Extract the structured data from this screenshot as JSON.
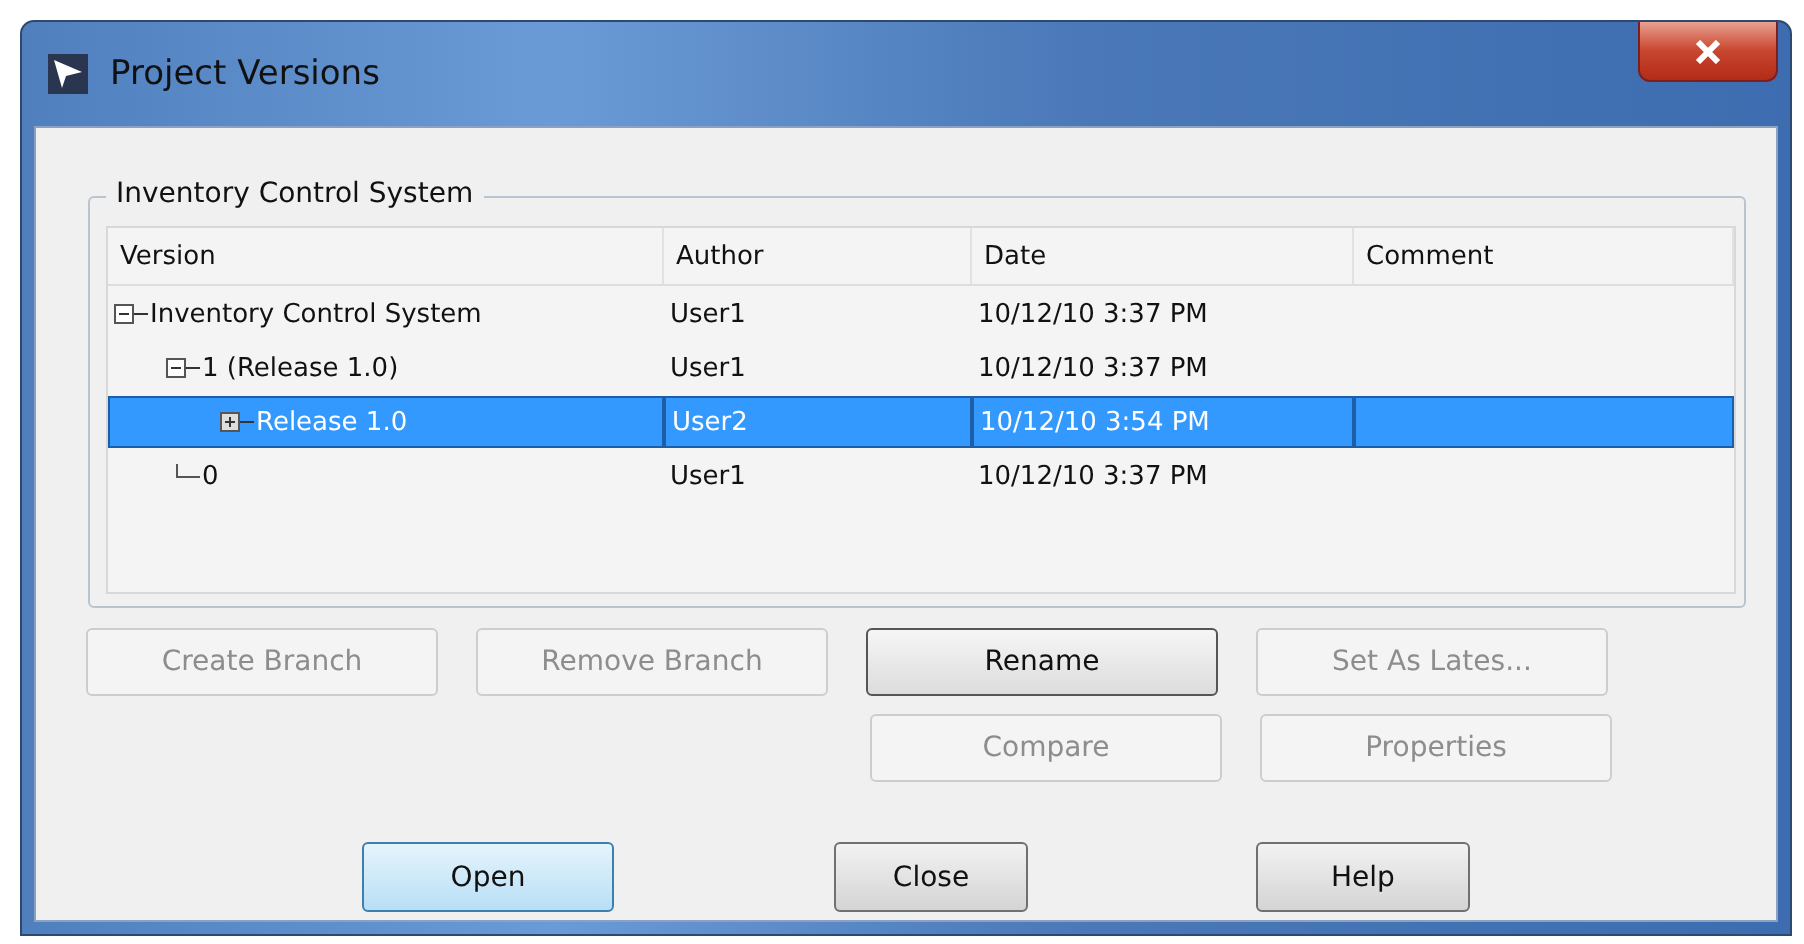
{
  "window": {
    "title": "Project Versions"
  },
  "group": {
    "title": "Inventory Control System"
  },
  "table": {
    "columns": [
      "Version",
      "Author",
      "Date",
      "Comment"
    ],
    "rows": [
      {
        "version": "Inventory Control System",
        "author": "User1",
        "date": "10/12/10 3:37 PM",
        "expanded": true,
        "selected": false,
        "children": [
          {
            "version": "1 (Release 1.0)",
            "author": "User1",
            "date": "10/12/10 3:37 PM",
            "expanded": true,
            "selected": false,
            "children": [
              {
                "version": "Release 1.0",
                "author": "User2",
                "date": "10/12/10 3:54 PM",
                "expanded": false,
                "selected": true
              }
            ]
          },
          {
            "version": "0",
            "author": "User1",
            "date": "10/12/10 3:37 PM",
            "selected": false
          }
        ]
      }
    ]
  },
  "actions": [
    {
      "label": "Create Branch",
      "disabled": true,
      "focused": false
    },
    {
      "label": "Remove Branch",
      "disabled": true,
      "focused": false
    },
    {
      "label": "Rename",
      "disabled": false,
      "focused": true
    },
    {
      "label": "Set As Lates...",
      "disabled": true,
      "focused": false
    },
    {
      "label": "Compare",
      "disabled": true,
      "focused": false
    },
    {
      "label": "Properties",
      "disabled": true,
      "focused": false
    }
  ],
  "buttons": [
    {
      "label": "Open",
      "default": true
    },
    {
      "label": "Close",
      "default": false
    },
    {
      "label": "Help",
      "default": false
    }
  ]
}
